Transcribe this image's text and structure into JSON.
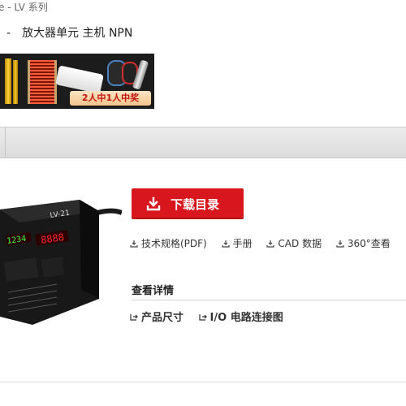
{
  "breadcrumb": "e - LV 系列",
  "subtitle": {
    "dash": "-",
    "text": "放大器单元 主机 NPN"
  },
  "banner": {
    "promo_label": "2人中1人中奖"
  },
  "device": {
    "screen_left": "8888",
    "screen_right": "1234",
    "model_label": "LV-21"
  },
  "download_button": {
    "label": "下载目录",
    "icon": "download-icon"
  },
  "doc_links": [
    {
      "label": "技术规格(PDF)",
      "icon": "download-icon"
    },
    {
      "label": "手册",
      "icon": "download-icon"
    },
    {
      "label": "CAD 数据",
      "icon": "download-icon"
    },
    {
      "label": "360°查看",
      "icon": "download-icon"
    }
  ],
  "details": {
    "title": "查看详情",
    "links": [
      {
        "label": "产品尺寸",
        "icon": "link-arrow-icon"
      },
      {
        "label": "I/O 电路连接图",
        "icon": "link-arrow-icon"
      }
    ]
  },
  "colors": {
    "accent": "#d8161d",
    "tabbar": "#e3e3e3",
    "banner_bg": "#1c1c1c"
  }
}
